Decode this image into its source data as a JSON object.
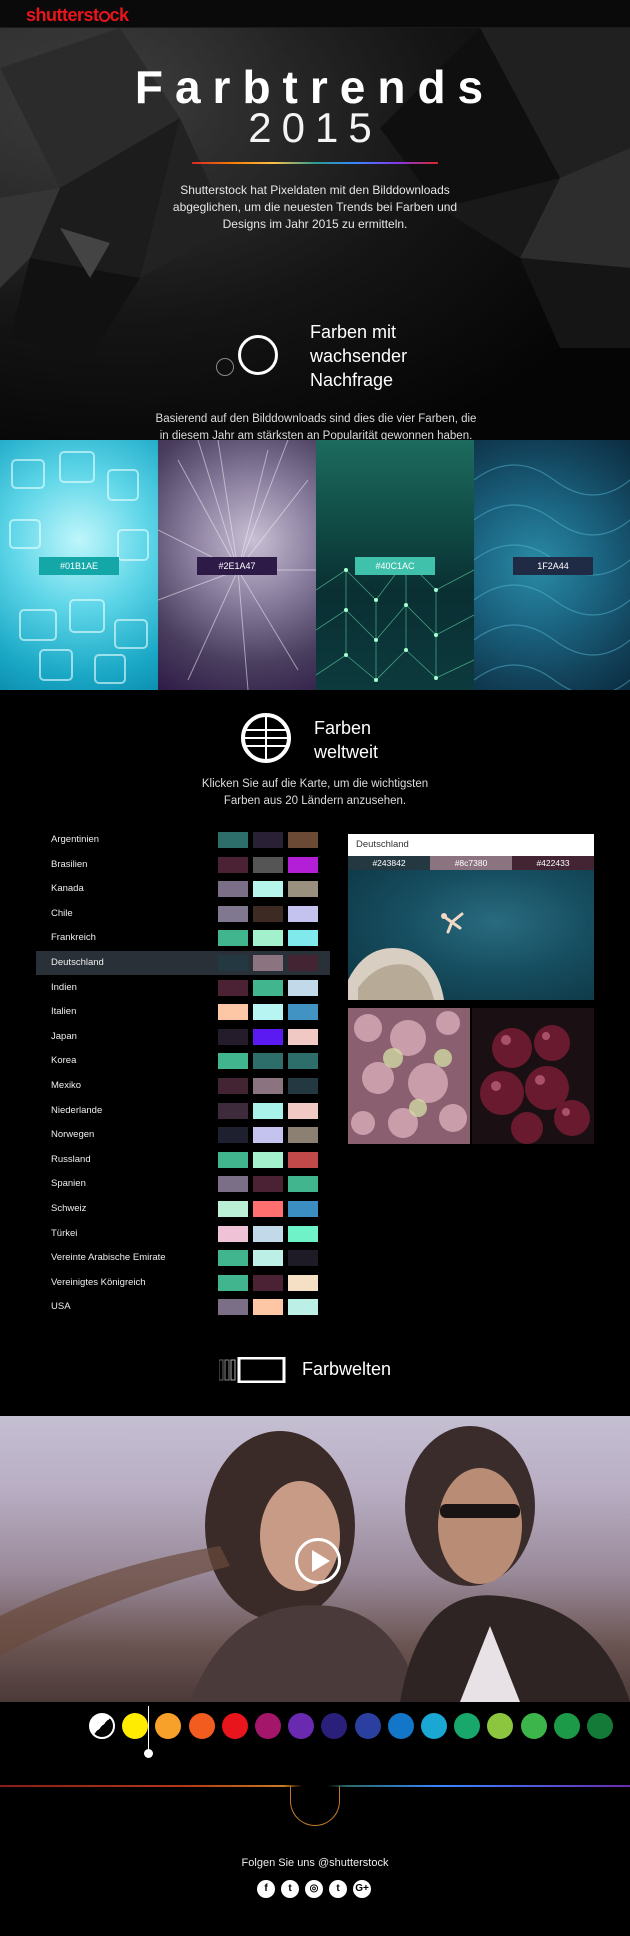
{
  "brand": {
    "logo_text": "shutterstock",
    "logo_color": "#e8161c"
  },
  "hero": {
    "title": "Farbtrends",
    "year": "2015",
    "intro": "Shutterstock hat Pixeldaten mit den Bilddownloads abgeglichen, um die neuesten Trends bei Farben und Designs im Jahr 2015 zu ermitteln."
  },
  "section_rising": {
    "title": "Farben mit wachsender Nachfrage",
    "description": "Basierend auf den Bilddownloads sind dies die vier Farben, die in diesem Jahr am stärksten an Popularität gewonnen haben.",
    "swatches": [
      {
        "label": "#01B1AE",
        "label_bg": "#13a7a8",
        "image": "ice-cubes"
      },
      {
        "label": "#2E1A47",
        "label_bg": "#2e1a47",
        "image": "dandelion-seeds"
      },
      {
        "label": "#40C1AC",
        "label_bg": "#40c1ac",
        "image": "network-landscape"
      },
      {
        "label": "1F2A44",
        "label_bg": "#1f2a44",
        "image": "blue-feathers"
      }
    ]
  },
  "section_world": {
    "title": "Farben weltweit",
    "description": "Klicken Sie auf die Karte, um die wichtigsten Farben aus 20 Ländern anzusehen.",
    "countries": [
      {
        "name": "Argentinien",
        "colors": [
          "#2d6e6b",
          "#2a2035",
          "#6a4a35"
        ]
      },
      {
        "name": "Brasilien",
        "colors": [
          "#4a2233",
          "#555555",
          "#b21fd6"
        ]
      },
      {
        "name": "Kanada",
        "colors": [
          "#7b6f88",
          "#b6f5ea",
          "#9a9080"
        ]
      },
      {
        "name": "Chile",
        "colors": [
          "#7f7890",
          "#3d2a22",
          "#c4c2ee"
        ]
      },
      {
        "name": "Frankreich",
        "colors": [
          "#40b58e",
          "#a2f1cc",
          "#7fe9ec"
        ]
      },
      {
        "name": "Deutschland",
        "colors": [
          "#243842",
          "#8c7380",
          "#422433"
        ]
      },
      {
        "name": "Indien",
        "colors": [
          "#4a2233",
          "#40b58e",
          "#c2d9ea"
        ]
      },
      {
        "name": "Italien",
        "colors": [
          "#fdc7a6",
          "#b6f5f1",
          "#4093c2"
        ]
      },
      {
        "name": "Japan",
        "colors": [
          "#241b2b",
          "#5c1af2",
          "#f0c9c4"
        ]
      },
      {
        "name": "Korea",
        "colors": [
          "#40b58e",
          "#2d6e6b",
          "#2d6e6b"
        ]
      },
      {
        "name": "Mexiko",
        "colors": [
          "#422433",
          "#8c7380",
          "#243842"
        ]
      },
      {
        "name": "Niederlande",
        "colors": [
          "#3d2a3a",
          "#a9f2ea",
          "#f0c9c4"
        ]
      },
      {
        "name": "Norwegen",
        "colors": [
          "#1e1f2f",
          "#c4c2ee",
          "#8c8072"
        ]
      },
      {
        "name": "Russland",
        "colors": [
          "#40b58e",
          "#a2f1cc",
          "#c04a4a"
        ]
      },
      {
        "name": "Spanien",
        "colors": [
          "#7b6f88",
          "#4a2233",
          "#40b58e"
        ]
      },
      {
        "name": "Schweiz",
        "colors": [
          "#bcf0d6",
          "#ff6f6f",
          "#3a8ec2"
        ]
      },
      {
        "name": "Türkei",
        "colors": [
          "#f0c2d6",
          "#c2d9ea",
          "#6ff2c8"
        ]
      },
      {
        "name": "Vereinte Arabische Emirate",
        "colors": [
          "#40b58e",
          "#bcf0e6",
          "#1e1a26"
        ]
      },
      {
        "name": "Vereinigtes Königreich",
        "colors": [
          "#40b58e",
          "#4a2233",
          "#f5e0c6"
        ]
      },
      {
        "name": "USA",
        "colors": [
          "#7b6f88",
          "#fdc7a6",
          "#bcf0e6"
        ]
      }
    ],
    "active_country": "Deutschland",
    "preview": {
      "country": "Deutschland",
      "hexes": [
        {
          "label": "#243842",
          "color": "#243842"
        },
        {
          "label": "#8c7380",
          "color": "#8c7380"
        },
        {
          "label": "#422433",
          "color": "#422433"
        }
      ]
    }
  },
  "section_worlds": {
    "title": "Farbwelten",
    "palette": [
      "bw",
      "#ffec00",
      "#f7a12b",
      "#f25c1e",
      "#e8161c",
      "#a3166a",
      "#6a2ab0",
      "#2a1f7a",
      "#2b3fa0",
      "#1476c8",
      "#1ba7d4",
      "#18a86b",
      "#8cc63f",
      "#3cb54a",
      "#1c9a48",
      "#147a37"
    ]
  },
  "footer": {
    "follow": "Folgen Sie uns @shutterstock",
    "social": [
      {
        "icon": "facebook-icon",
        "glyph": "f"
      },
      {
        "icon": "twitter-icon",
        "glyph": "t"
      },
      {
        "icon": "instagram-icon",
        "glyph": "◎"
      },
      {
        "icon": "tumblr-icon",
        "glyph": "t"
      },
      {
        "icon": "googleplus-icon",
        "glyph": "G+"
      }
    ]
  }
}
